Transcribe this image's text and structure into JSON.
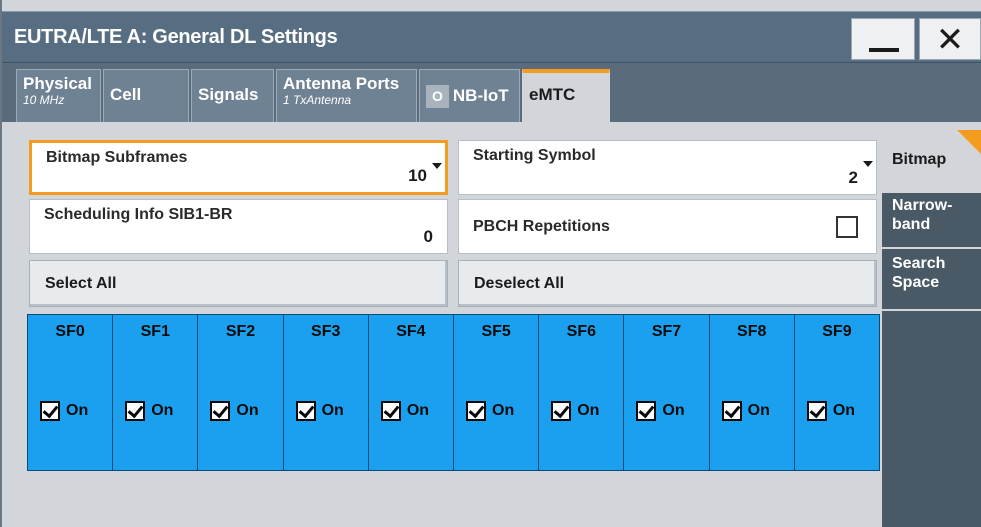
{
  "window": {
    "title": "EUTRA/LTE A: General DL Settings",
    "minimize_icon": "minimize-icon",
    "close_icon": "close-icon",
    "close_glyph": "✕"
  },
  "tabs": [
    {
      "label": "Physical",
      "sub": "10 MHz"
    },
    {
      "label": "Cell",
      "sub": ""
    },
    {
      "label": "Signals",
      "sub": ""
    },
    {
      "label": "Antenna Ports",
      "sub": "1 TxAntenna"
    },
    {
      "label": "NB-IoT",
      "state": "O"
    },
    {
      "label": "eMTC",
      "active": true
    }
  ],
  "fields": {
    "bitmap_subframes": {
      "label": "Bitmap Subframes",
      "value": "10"
    },
    "starting_symbol": {
      "label": "Starting Symbol",
      "value": "2"
    },
    "scheduling_info": {
      "label": "Scheduling Info SIB1-BR",
      "value": "0"
    },
    "pbch_repetitions": {
      "label": "PBCH Repetitions",
      "checked": false
    }
  },
  "buttons": {
    "select_all": "Select All",
    "deselect_all": "Deselect All"
  },
  "subframes": [
    {
      "name": "SF0",
      "state": "On",
      "checked": true
    },
    {
      "name": "SF1",
      "state": "On",
      "checked": true
    },
    {
      "name": "SF2",
      "state": "On",
      "checked": true
    },
    {
      "name": "SF3",
      "state": "On",
      "checked": true
    },
    {
      "name": "SF4",
      "state": "On",
      "checked": true
    },
    {
      "name": "SF5",
      "state": "On",
      "checked": true
    },
    {
      "name": "SF6",
      "state": "On",
      "checked": true
    },
    {
      "name": "SF7",
      "state": "On",
      "checked": true
    },
    {
      "name": "SF8",
      "state": "On",
      "checked": true
    },
    {
      "name": "SF9",
      "state": "On",
      "checked": true
    }
  ],
  "sidenav": [
    {
      "label": "Bitmap",
      "active": true
    },
    {
      "label": "Narrow-\nband"
    },
    {
      "label": "Search\nSpace"
    }
  ],
  "colors": {
    "accent": "#f39c1f",
    "subframe_on": "#1aa0ef",
    "titlebar": "#566d82"
  }
}
